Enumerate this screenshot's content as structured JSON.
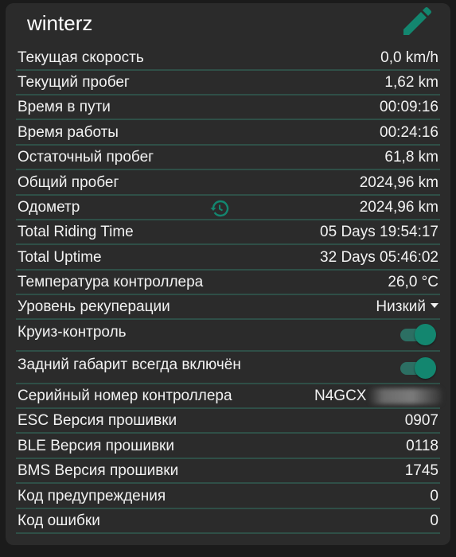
{
  "device_name": "winterz",
  "icons": {
    "edit": "edit-pencil-icon",
    "history": "history-icon",
    "dropdown": "chevron-down-icon"
  },
  "colors": {
    "accent": "#13866f",
    "divider": "#2f4f47",
    "card_bg": "#2b2b2b",
    "page_bg": "#1b1b1b"
  },
  "rows": [
    {
      "label": "Текущая скорость",
      "value": "0,0 km/h"
    },
    {
      "label": "Текущий пробег",
      "value": "1,62 km"
    },
    {
      "label": "Время в пути",
      "value": "00:09:16"
    },
    {
      "label": "Время работы",
      "value": "00:24:16"
    },
    {
      "label": "Остаточный пробег",
      "value": "61,8 km"
    },
    {
      "label": "Общий пробег",
      "value": "2024,96 km"
    },
    {
      "label": "Одометр",
      "value": "2024,96 km"
    },
    {
      "label": "Total Riding Time",
      "value": "05 Days 19:54:17"
    },
    {
      "label": "Total Uptime",
      "value": "32 Days 05:46:02"
    },
    {
      "label": "Температура контроллера",
      "value": "26,0 °C"
    },
    {
      "label": "Уровень рекуперации",
      "value": "Низкий"
    },
    {
      "label": "Круиз-контроль",
      "value": true
    },
    {
      "label": "Задний габарит всегда включён",
      "value": true
    },
    {
      "label": "Серийный номер контроллера",
      "value": "N4GCX"
    },
    {
      "label": "ESC Версия прошивки",
      "value": "0907"
    },
    {
      "label": "BLE Версия прошивки",
      "value": "0118"
    },
    {
      "label": "BMS Версия прошивки",
      "value": "1745"
    },
    {
      "label": "Код предупреждения",
      "value": "0"
    },
    {
      "label": "Код ошибки",
      "value": "0"
    }
  ]
}
